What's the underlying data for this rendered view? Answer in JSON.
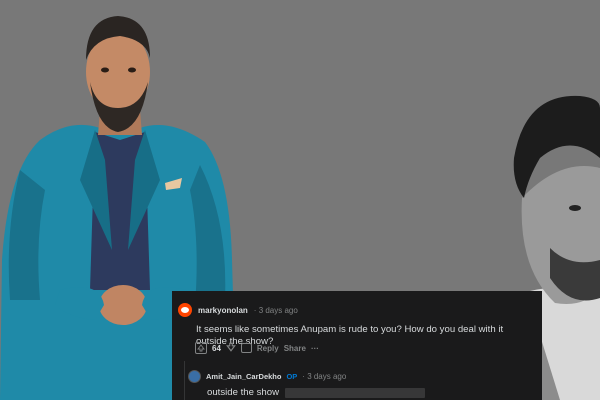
{
  "comment": {
    "username": "markyonolan",
    "time": "3 days ago",
    "text": "It seems like sometimes Anupam is rude to you? How do you deal with it outside the show?",
    "score": "64",
    "reply_label": "Reply",
    "share_label": "Share",
    "more_label": "···"
  },
  "reply": {
    "username": "Amit_Jain_CarDekho",
    "op_badge": "OP",
    "time": "3 days ago",
    "text": "outside the show"
  },
  "colors": {
    "background": "#787878",
    "card": "#1a1a1b",
    "accent_orange": "#ff4500",
    "op_blue": "#0079d3",
    "suit_teal": "#1f8aa8"
  }
}
